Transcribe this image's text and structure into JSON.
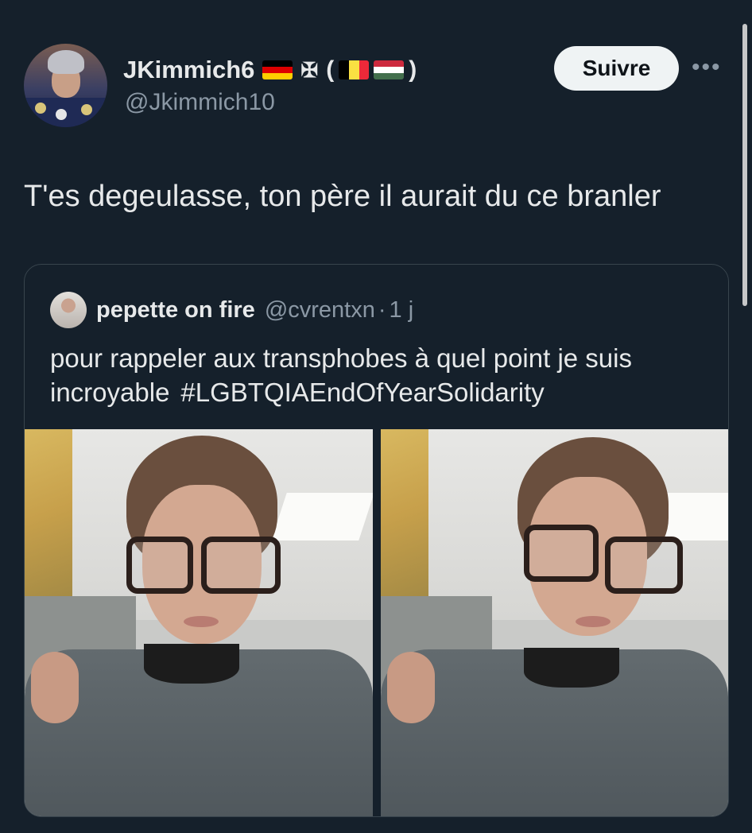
{
  "author": {
    "name": "JKimmich6",
    "handle": "@Jkimmich10",
    "cross_glyph": "✠",
    "paren_open": "(",
    "paren_close": ")",
    "flags": [
      "germany-flag",
      "belgium-flag",
      "hungary-flag"
    ]
  },
  "actions": {
    "follow_label": "Suivre",
    "more_label": "•••"
  },
  "tweet": {
    "text": "T'es degeulasse, ton père il aurait du ce branler"
  },
  "quote": {
    "name": "pepette on fire",
    "handle": "@cvrentxn",
    "separator": "·",
    "time": "1 j",
    "text": "pour rappeler aux transphobes à quel point je suis incroyable",
    "hashtag": "#LGBTQIAEndOfYearSolidarity",
    "photos": [
      "selfie-photo",
      "selfie-photo"
    ]
  },
  "colors": {
    "background": "#15202b",
    "text": "#e7e9ea",
    "secondary": "#8b98a5",
    "border": "#38444d",
    "follow_bg": "#eff3f4"
  }
}
